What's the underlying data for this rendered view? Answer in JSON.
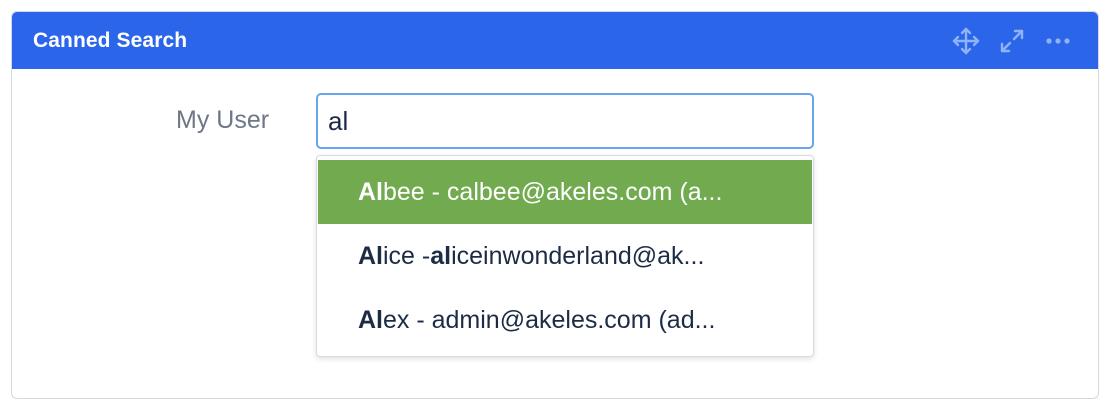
{
  "panel": {
    "title": "Canned Search",
    "header_icons": [
      "move-icon",
      "expand-icon",
      "more-icon"
    ],
    "header_color": "#2b66ea"
  },
  "form": {
    "label": "My User",
    "input_value": "al"
  },
  "dropdown": {
    "items": [
      {
        "match": "Al",
        "rest": "bee - calbee@akeles.com (a...",
        "selected": true
      },
      {
        "match": "Al",
        "rest_a": "ice - ",
        "match2": "al",
        "rest_b": "iceinwonderland@ak...",
        "selected": false
      },
      {
        "match": "Al",
        "rest": "ex - admin@akeles.com (ad...",
        "selected": false
      }
    ],
    "highlight_color": "#72aa4f"
  }
}
